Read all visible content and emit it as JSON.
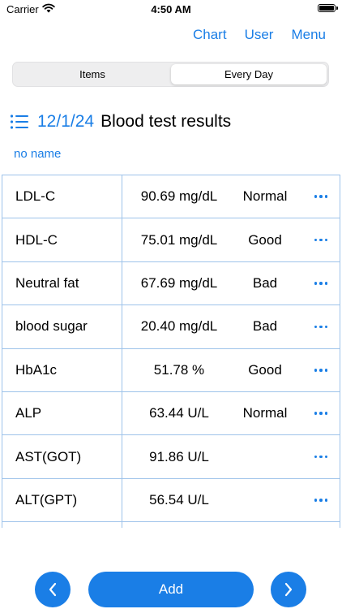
{
  "status_bar": {
    "carrier": "Carrier",
    "time": "4:50 AM"
  },
  "nav": {
    "chart": "Chart",
    "user": "User",
    "menu": "Menu"
  },
  "segments": {
    "left": "Items",
    "right": "Every Day",
    "selected": "Every Day"
  },
  "header": {
    "date": "12/1/24",
    "title": "Blood test results",
    "subtitle": "no name"
  },
  "rows": [
    {
      "name": "LDL-C",
      "value": "90.69 mg/dL",
      "status": "Normal"
    },
    {
      "name": "HDL-C",
      "value": "75.01 mg/dL",
      "status": "Good"
    },
    {
      "name": "Neutral fat",
      "value": "67.69 mg/dL",
      "status": "Bad"
    },
    {
      "name": "blood sugar",
      "value": "20.40 mg/dL",
      "status": "Bad"
    },
    {
      "name": "HbA1c",
      "value": "51.78 %",
      "status": "Good"
    },
    {
      "name": "ALP",
      "value": "63.44 U/L",
      "status": "Normal"
    },
    {
      "name": "AST(GOT)",
      "value": "91.86 U/L",
      "status": ""
    },
    {
      "name": "ALT(GPT)",
      "value": "56.54 U/L",
      "status": ""
    },
    {
      "name": "",
      "value": "",
      "status": ""
    }
  ],
  "bottom": {
    "add": "Add"
  },
  "colors": {
    "accent": "#1a7ee6",
    "grid": "#9ec3ea"
  },
  "icons": {
    "wifi": "wifi-icon",
    "battery": "battery-icon",
    "list": "list-icon",
    "more": "more-icon",
    "prev": "chevron-left-icon",
    "next": "chevron-right-icon"
  }
}
